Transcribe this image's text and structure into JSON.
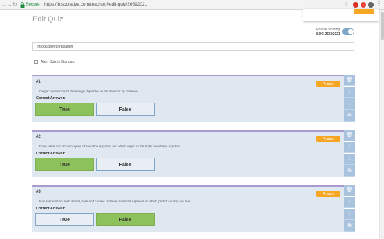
{
  "browser": {
    "secure_label": "Secure",
    "url": "https://b.socrative.com/teacher/#edit-quiz/26692021"
  },
  "page": {
    "title": "Edit Quiz",
    "sharing_label": "Enable Sharing",
    "soc_number": "SOC-26692021",
    "quiz_name": "Introduction to radiation",
    "align_label": "Align Quiz to Standard"
  },
  "common": {
    "correct_answer_label": "Correct Answer:",
    "edit_label": "EDIT"
  },
  "questions": [
    {
      "number": "#1",
      "text": "Geiger counter count the energy deposited in the detector by radiation.",
      "answers": [
        "True",
        "False"
      ],
      "correct": "True"
    },
    {
      "number": "#2",
      "text": "Dose takes into account types of radiation exposed and which organ in the body have been exposed.",
      "answers": [
        "True",
        "False"
      ],
      "correct": "True"
    },
    {
      "number": "#3",
      "text": "Natural radiation such as soil, rock and cosmic radiation does not depends on which part of country you live.",
      "answers": [
        "True",
        "False"
      ],
      "correct": "False"
    }
  ],
  "colors": {
    "correct": "#8dc15c",
    "edit": "#f6a623",
    "card_bg": "#dfe7f0",
    "card_border": "#a99bd0",
    "side_button": "#a9c2dd"
  },
  "icons": [
    "back-icon",
    "forward-icon",
    "reload-icon",
    "lock-icon",
    "star-icon",
    "trash-icon",
    "arrow-up-icon",
    "arrow-down-icon",
    "copy-icon",
    "pencil-icon"
  ]
}
